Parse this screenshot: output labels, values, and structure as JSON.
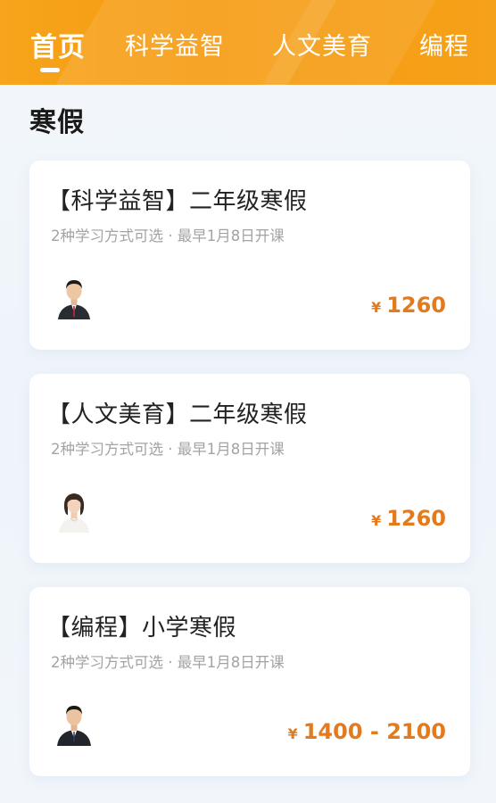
{
  "tabs": [
    {
      "label": "首页",
      "active": true
    },
    {
      "label": "科学益智",
      "active": false
    },
    {
      "label": "人文美育",
      "active": false
    },
    {
      "label": "编程",
      "active": false
    }
  ],
  "section": {
    "title": "寒假"
  },
  "courses": [
    {
      "title": "【科学益智】二年级寒假",
      "subtitle": "2种学习方式可选 · 最早1月8日开课",
      "currency": "¥",
      "price": "1260",
      "teacher": "male teacher in suit"
    },
    {
      "title": "【人文美育】二年级寒假",
      "subtitle": "2种学习方式可选 · 最早1月8日开课",
      "currency": "¥",
      "price": "1260",
      "teacher": "female teacher in white"
    },
    {
      "title": "【编程】小学寒假",
      "subtitle": "2种学习方式可选 · 最早1月8日开课",
      "currency": "¥",
      "price": "1400 - 2100",
      "teacher": "male teacher in suit"
    }
  ],
  "colors": {
    "brand": "#f7a51c",
    "price": "#e37a1d"
  }
}
